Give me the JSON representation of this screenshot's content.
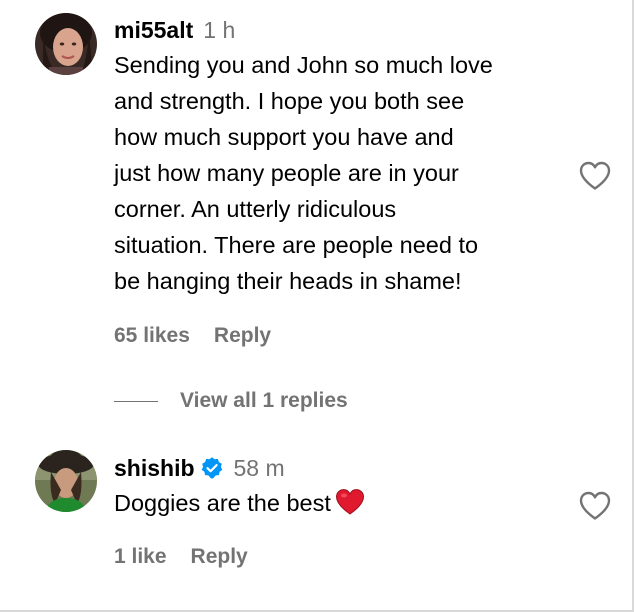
{
  "comments": [
    {
      "username": "mi55alt",
      "time": "1 h",
      "verified": false,
      "text_lines": [
        "Sending you and John so much love",
        "and strength. I hope you both see",
        "how much support you have and",
        "just how many people are in your",
        "corner. An utterly ridiculous",
        "situation. There are people need to",
        "be hanging their heads in shame!"
      ],
      "likes": "65 likes",
      "reply_label": "Reply",
      "view_replies": "View all 1 replies"
    },
    {
      "username": "shishib",
      "time": "58 m",
      "verified": true,
      "text": "Doggies are the best",
      "emoji": "red-heart",
      "likes": "1 like",
      "reply_label": "Reply"
    }
  ],
  "colors": {
    "text": "#000000",
    "secondary": "#737373",
    "verified_badge": "#0095f6",
    "heart_emoji": "#e0192e"
  },
  "icons": {
    "like": "heart-outline-icon",
    "verified": "verified-badge-icon",
    "emoji": "red-heart-emoji"
  }
}
